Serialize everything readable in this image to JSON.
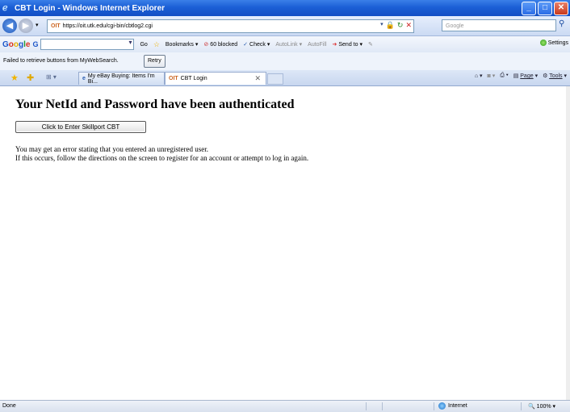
{
  "window": {
    "title": "CBT Login - Windows Internet Explorer",
    "buttons": {
      "minimize": "_",
      "maximize": "□",
      "close": "✕"
    }
  },
  "address_bar": {
    "site_label": "OIT",
    "url": "https://oit.utk.edu/cgi-bin/cbtlog2.cgi",
    "search_placeholder": "Google"
  },
  "google_toolbar": {
    "logo": {
      "g1": "G",
      "o1": "o",
      "o2": "o",
      "g2": "g",
      "l": "l",
      "e": "e"
    },
    "g_label": "G",
    "go_label": "Go",
    "bookmarks_label": "Bookmarks",
    "blocked_label": "60 blocked",
    "check_label": "Check",
    "autolink_label": "AutoLink",
    "autofill_label": "AutoFill",
    "sendto_label": "Send to",
    "settings_label": "Settings"
  },
  "message_bar": {
    "text": "Failed to retrieve buttons from MyWebSearch.",
    "retry_label": "Retry"
  },
  "tabs": [
    {
      "label": "My eBay Buying: Items I'm Bi...",
      "icon": "e"
    },
    {
      "label": "CBT Login",
      "icon": "OIT",
      "close": "✕"
    }
  ],
  "command_bar": {
    "page_label": "Page",
    "tools_label": "Tools"
  },
  "page": {
    "heading": "Your NetId and Password have been authenticated",
    "enter_button": "Click to Enter Skillport CBT",
    "line1": "You may get an error stating that you entered an unregistered user.",
    "line2": "If this occurs, follow the directions on the screen to register for an account or attempt to log in again."
  },
  "status_bar": {
    "status": "Done",
    "zone": "Internet",
    "zoom": "100%"
  }
}
